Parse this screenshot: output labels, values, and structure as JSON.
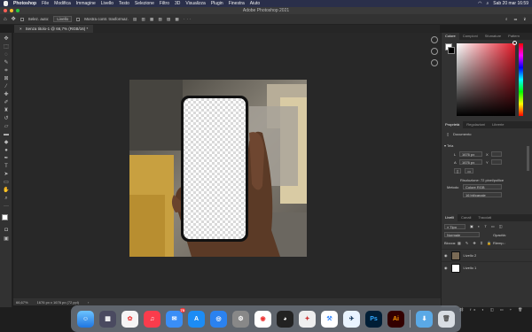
{
  "menubar": {
    "app": "Photoshop",
    "items": [
      "File",
      "Modifica",
      "Immagine",
      "Livello",
      "Testo",
      "Selezione",
      "Filtro",
      "3D",
      "Visualizza",
      "Plugin",
      "Finestra",
      "Aiuto"
    ],
    "clock": "Sab 20 mar  16:59"
  },
  "window": {
    "title": "Adobe Photoshop 2021"
  },
  "options": {
    "blend_label": "Selez. auto:",
    "blend_value": "Livello",
    "transform_label": "Mostra contr. trasformaz."
  },
  "document": {
    "tab_title": "Senza titolo-1 @ 66,7% (RGB/16) *",
    "close": "×"
  },
  "status": {
    "zoom": "66,67%",
    "size": "1676 px x 1676 px (72 ppi)"
  },
  "color_panel": {
    "tabs": [
      "Colore",
      "Campioni",
      "Sfumature",
      "Pattern"
    ],
    "accent": "#e41b2a"
  },
  "properties": {
    "tabs": [
      "Proprietà",
      "Regolazioni",
      "Librerie"
    ],
    "doc_label": "Documento",
    "canvas_label": "Tela",
    "w_label": "L",
    "w_value": "1676 px",
    "x_label": "X",
    "h_label": "A",
    "h_value": "1676 px",
    "y_label": "Y",
    "resolution": "Risoluzione: 72 pixel/pollice",
    "mode_label": "Metodo",
    "mode_value": "Colore RGB",
    "depth_value": "16 bit/canale"
  },
  "layers_panel": {
    "tabs": [
      "Livelli",
      "Canali",
      "Tracciati"
    ],
    "kind": "Tipo",
    "blend": "Normale",
    "opacity_label": "Opacità:",
    "lock_label": "Blocca:",
    "fill_label": "Riemp.:",
    "layers": [
      {
        "name": "Livello 2"
      },
      {
        "name": "Livello 1"
      }
    ]
  },
  "dock": {
    "ps": "Ps",
    "ai": "Ai",
    "badge": "75"
  }
}
